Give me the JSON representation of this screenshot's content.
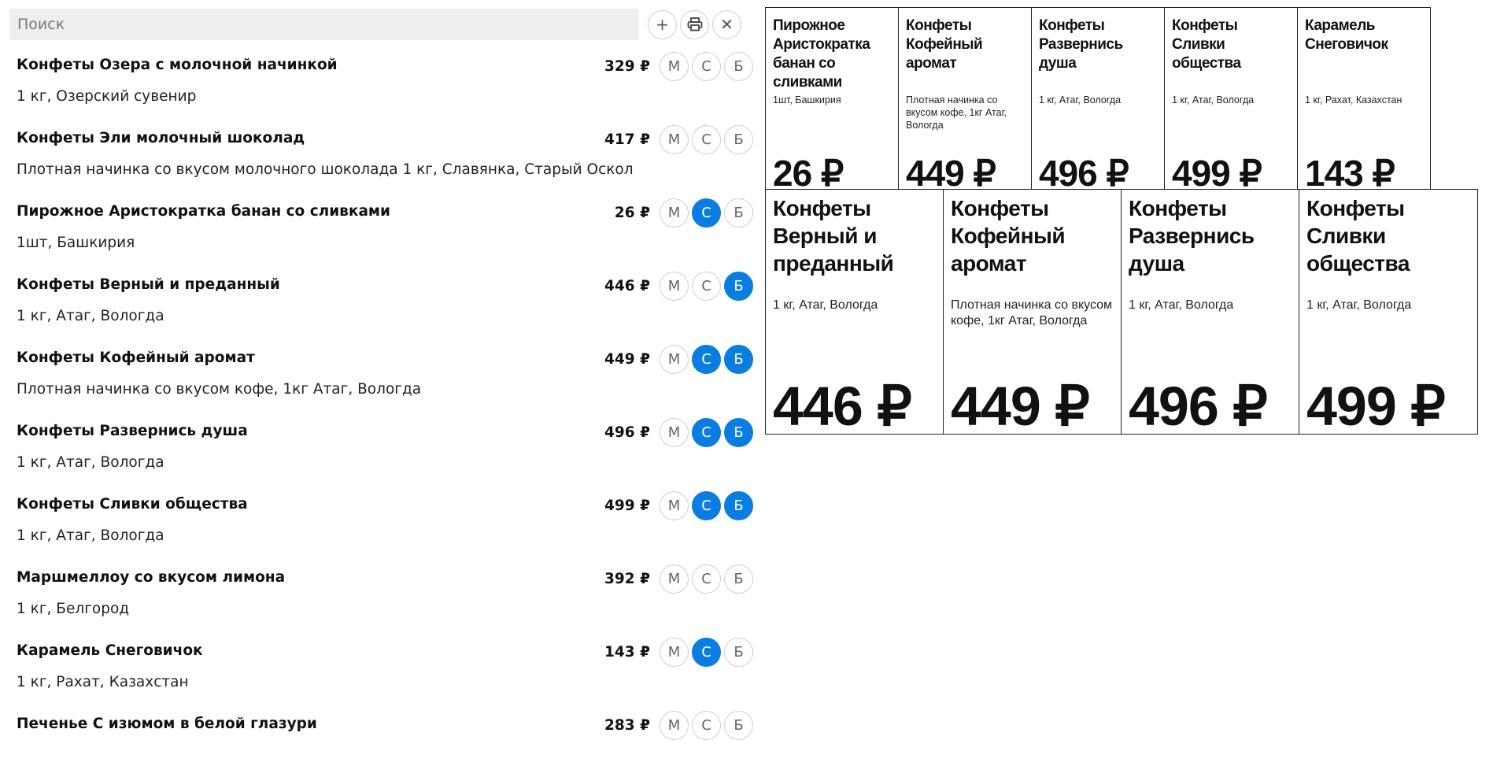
{
  "search": {
    "placeholder": "Поиск"
  },
  "toolbar": {
    "add_symbol": "+",
    "close_symbol": "✕"
  },
  "currency": "₽",
  "size_labels": [
    "М",
    "С",
    "Б"
  ],
  "accent_color": "#0a7de0",
  "products": [
    {
      "name": "Конфеты Озера с молочной начинкой",
      "desc": "1 кг, Озерский сувенир",
      "price": "329",
      "selected": [
        false,
        false,
        false
      ]
    },
    {
      "name": "Конфеты Эли молочный шоколад",
      "desc": "Плотная начинка со вкусом молочного шоколада 1 кг, Славянка, Старый Оскол",
      "price": "417",
      "selected": [
        false,
        false,
        false
      ]
    },
    {
      "name": "Пирожное Аристократка банан со сливками",
      "desc": "1шт, Башкирия",
      "price": "26",
      "selected": [
        false,
        true,
        false
      ]
    },
    {
      "name": "Конфеты Верный и преданный",
      "desc": "1 кг,  Атаг, Вологда",
      "price": "446",
      "selected": [
        false,
        false,
        true
      ]
    },
    {
      "name": "Конфеты Кофейный аромат",
      "desc": "Плотная начинка со вкусом кофе, 1кг Атаг, Вологда",
      "price": "449",
      "selected": [
        false,
        true,
        true
      ]
    },
    {
      "name": "Конфеты Развернись душа",
      "desc": "1 кг,  Атаг, Вологда",
      "price": "496",
      "selected": [
        false,
        true,
        true
      ]
    },
    {
      "name": "Конфеты Сливки общества",
      "desc": "1 кг,  Атаг, Вологда",
      "price": "499",
      "selected": [
        false,
        true,
        true
      ]
    },
    {
      "name": "Маршмеллоу со вкусом лимона",
      "desc": "1 кг, Белгород",
      "price": "392",
      "selected": [
        false,
        false,
        false
      ]
    },
    {
      "name": "Карамель Снеговичок",
      "desc": "1 кг, Рахат, Казахстан",
      "price": "143",
      "selected": [
        false,
        true,
        false
      ]
    },
    {
      "name": "Печенье С изюмом в белой глазури",
      "desc": "",
      "price": "283",
      "selected": [
        false,
        false,
        false
      ]
    }
  ],
  "tags_small": [
    {
      "name": "Пирожное Аристократка банан со сливками",
      "desc": "1шт, Башкирия",
      "price": "26 ₽"
    },
    {
      "name": "Конфеты Кофейный аромат",
      "desc": "Плотная начинка со вкусом кофе, 1кг Атаг, Вологда",
      "price": "449 ₽"
    },
    {
      "name": "Конфеты Развернись душа",
      "desc": "1 кг, Атаг, Вологда",
      "price": "496 ₽"
    },
    {
      "name": "Конфеты Сливки общества",
      "desc": "1 кг, Атаг, Вологда",
      "price": "499 ₽"
    },
    {
      "name": "Карамель Снеговичок",
      "desc": "1 кг, Рахат, Казахстан",
      "price": "143 ₽"
    }
  ],
  "tags_big": [
    {
      "name": "Конфеты Верный и преданный",
      "desc": "1 кг, Атаг, Вологда",
      "price": "446 ₽"
    },
    {
      "name": "Конфеты Кофейный аромат",
      "desc": "Плотная начинка со вкусом кофе, 1кг Атаг, Вологда",
      "price": "449 ₽"
    },
    {
      "name": "Конфеты Развернись душа",
      "desc": "1 кг, Атаг, Вологда",
      "price": "496 ₽"
    },
    {
      "name": "Конфеты Сливки общества",
      "desc": "1 кг, Атаг, Вологда",
      "price": "499 ₽"
    }
  ]
}
